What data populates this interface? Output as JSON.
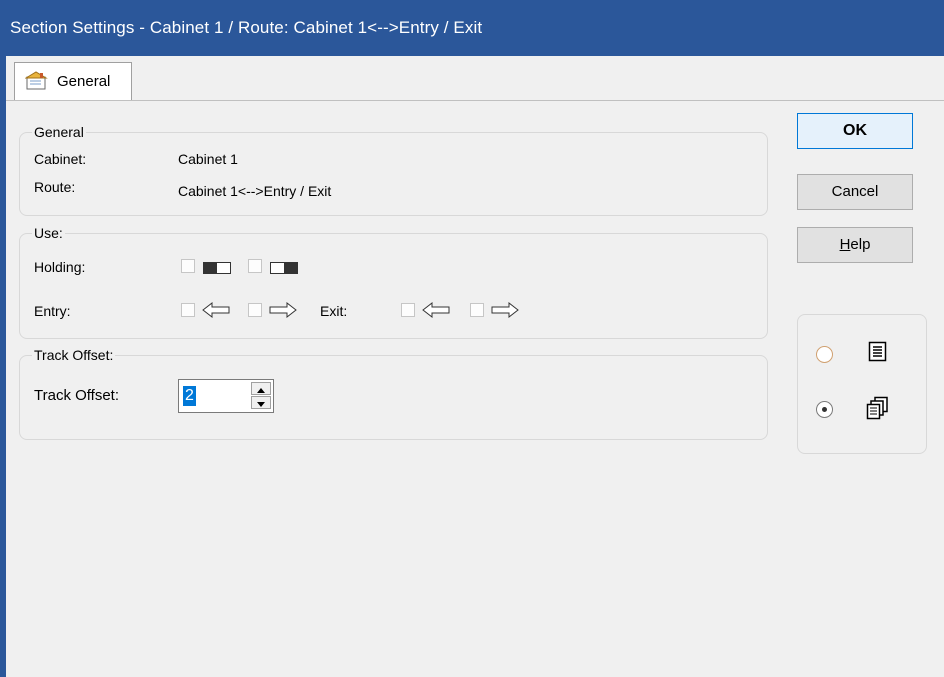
{
  "window": {
    "title": "Section Settings - Cabinet 1 / Route: Cabinet 1<-->Entry / Exit"
  },
  "tabs": [
    {
      "label": "General",
      "icon": "settings-sheet-icon"
    }
  ],
  "general": {
    "legend": "General",
    "cabinet_label": "Cabinet:",
    "cabinet_value": "Cabinet 1",
    "route_label": "Route:",
    "route_value": "Cabinet 1<-->Entry / Exit"
  },
  "use": {
    "legend": "Use:",
    "holding_label": "Holding:",
    "entry_label": "Entry:",
    "exit_label": "Exit:",
    "holding_options": [
      {
        "icon": "holding-left-icon",
        "checked": false
      },
      {
        "icon": "holding-right-icon",
        "checked": false
      }
    ],
    "entry_options": [
      {
        "icon": "arrow-left-icon",
        "checked": false
      },
      {
        "icon": "arrow-right-icon",
        "checked": false
      }
    ],
    "exit_options": [
      {
        "icon": "arrow-left-icon",
        "checked": false
      },
      {
        "icon": "arrow-right-icon",
        "checked": false
      }
    ]
  },
  "track_offset": {
    "legend": "Track Offset:",
    "label": "Track Offset:",
    "value": "2"
  },
  "buttons": {
    "ok": "OK",
    "cancel": "Cancel",
    "help_mnemonic": "H",
    "help_rest": "elp"
  },
  "view_options": [
    {
      "icon": "single-list-icon",
      "selected": false
    },
    {
      "icon": "multiple-pages-icon",
      "selected": true
    }
  ],
  "colors": {
    "titlebar": "#2b579a",
    "default_button_border": "#0078d7",
    "selection": "#0078d7"
  }
}
